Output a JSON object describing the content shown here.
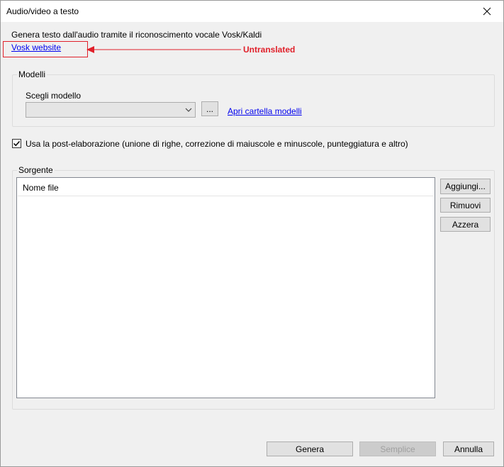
{
  "window": {
    "title": "Audio/video a testo"
  },
  "header": {
    "description": "Genera testo dall'audio tramite il riconoscimento vocale Vosk/Kaldi",
    "website_link": "Vosk website"
  },
  "annotation": {
    "label": "Untranslated",
    "color": "#e0202a"
  },
  "models": {
    "group_label": "Modelli",
    "choose_label": "Scegli modello",
    "selected_value": "",
    "browse_label": "...",
    "open_folder_link": "Apri cartella modelli"
  },
  "postprocess": {
    "checked": true,
    "label": "Usa la post-elaborazione (unione di righe, correzione di maiuscole e minuscole, punteggiatura e altro)"
  },
  "source": {
    "group_label": "Sorgente",
    "column_header": "Nome file",
    "rows": [],
    "add_label": "Aggiungi...",
    "remove_label": "Rimuovi",
    "clear_label": "Azzera"
  },
  "footer": {
    "generate_label": "Genera",
    "simple_label": "Semplice",
    "cancel_label": "Annulla"
  }
}
